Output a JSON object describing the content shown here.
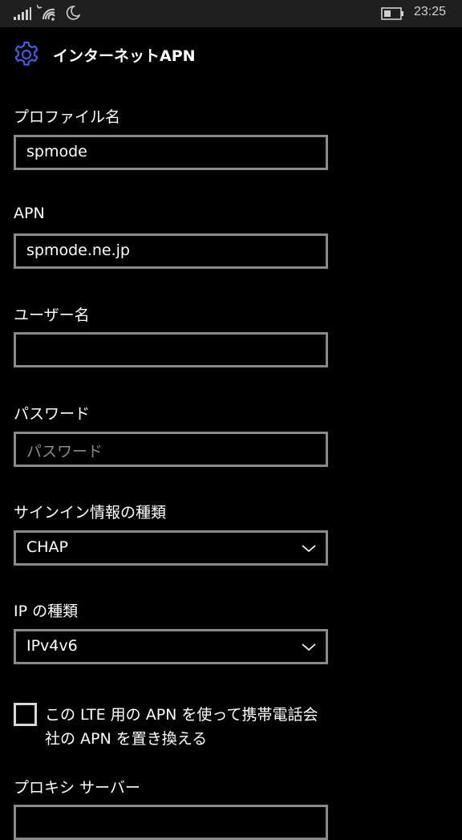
{
  "status_bar": {
    "time": "23:25",
    "icons": [
      "signal-icon",
      "wifi-icon",
      "quiet-hours-icon",
      "battery-icon"
    ]
  },
  "header": {
    "icon": "gear-icon",
    "title": "インターネットAPN"
  },
  "form": {
    "profile_name": {
      "label": "プロファイル名",
      "value": "spmode"
    },
    "apn": {
      "label": "APN",
      "value": "spmode.ne.jp"
    },
    "username": {
      "label": "ユーザー名",
      "value": ""
    },
    "password": {
      "label": "パスワード",
      "placeholder": "パスワード"
    },
    "signin_type": {
      "label": "サインイン情報の種類",
      "value": "CHAP"
    },
    "ip_type": {
      "label": "IP の種類",
      "value": "IPv4v6"
    },
    "override_checkbox": {
      "label": "この LTE 用の APN を使って携帯電話会社の APN を置き換える",
      "checked": false
    },
    "proxy_server": {
      "label": "プロキシ サーバー",
      "value": ""
    }
  },
  "colors": {
    "background": "#000000",
    "status_bar": "#1f1f1f",
    "accent": "#3b5fe0",
    "field_border": "#8a8a8a",
    "text": "#ffffff",
    "placeholder": "#8a8a8a"
  }
}
